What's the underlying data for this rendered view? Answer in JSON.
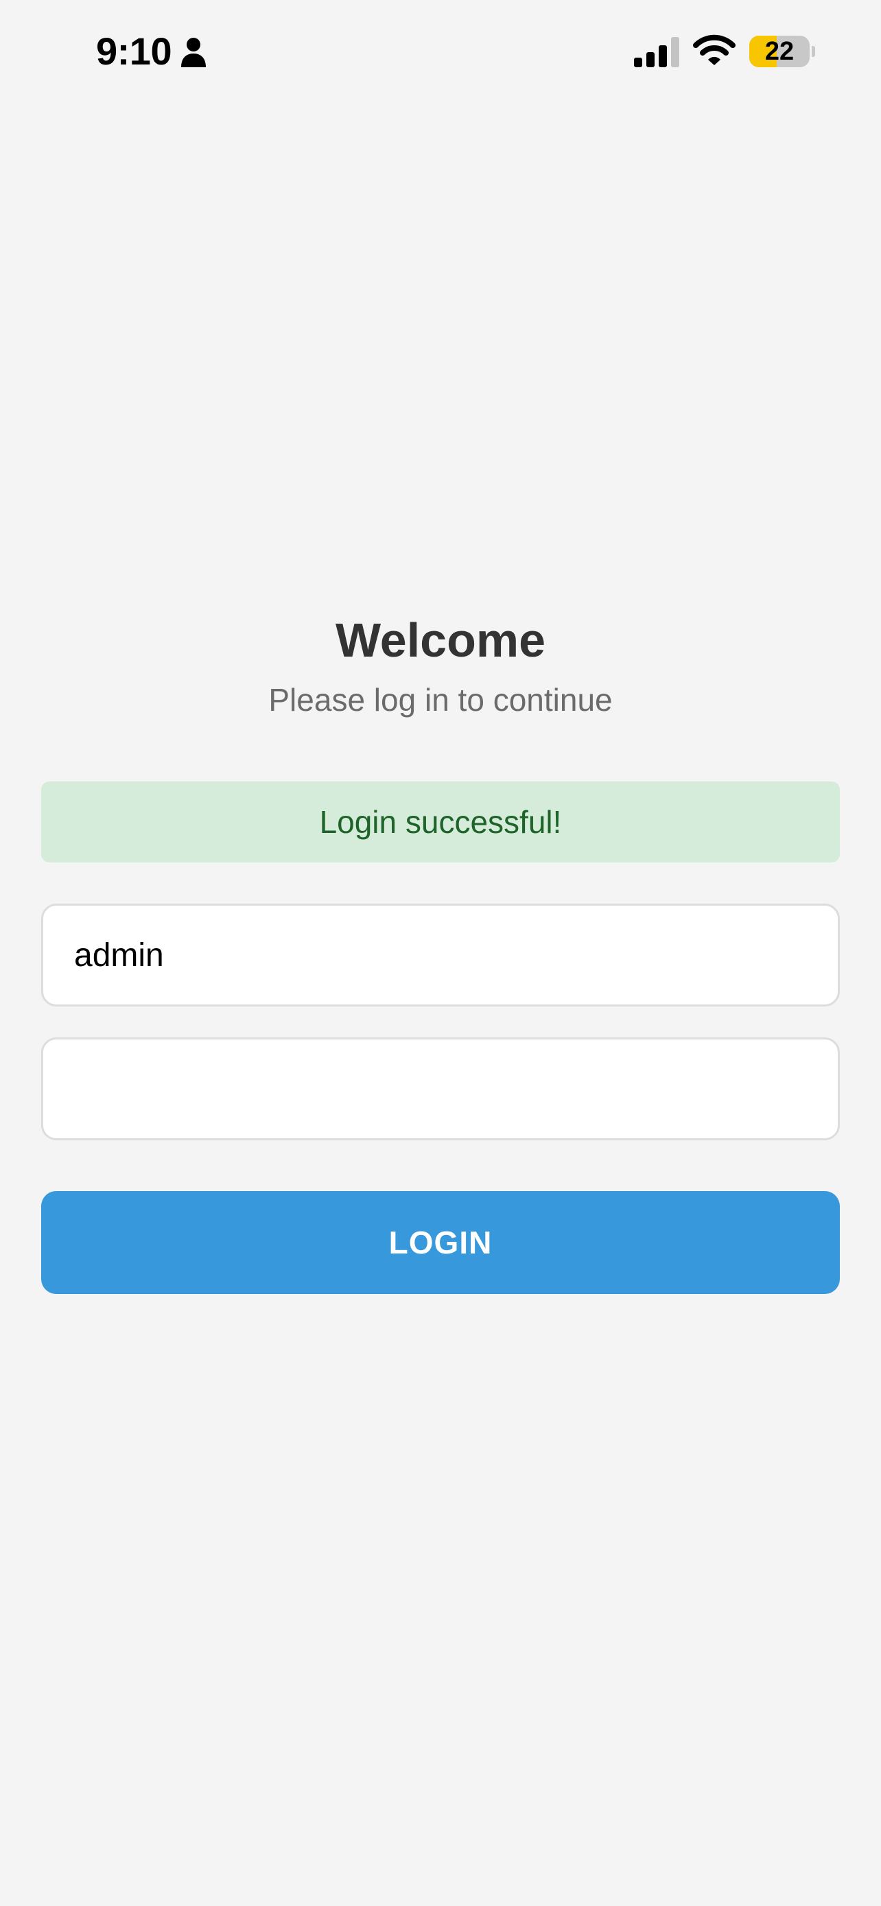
{
  "status_bar": {
    "time": "9:10",
    "battery_level": "22",
    "battery_fraction": 0.45,
    "icons": [
      "person-icon",
      "cellular-signal-icon",
      "wifi-icon",
      "battery-icon"
    ]
  },
  "login": {
    "title": "Welcome",
    "subtitle": "Please log in to continue",
    "message": "Login successful!",
    "username_value": "admin",
    "password_value": "",
    "button_label": "LOGIN"
  },
  "colors": {
    "background": "#f4f4f4",
    "primary": "#3798db",
    "success_bg": "#d6ecdb",
    "success_text": "#1e6428",
    "battery_low": "#f7c600"
  }
}
